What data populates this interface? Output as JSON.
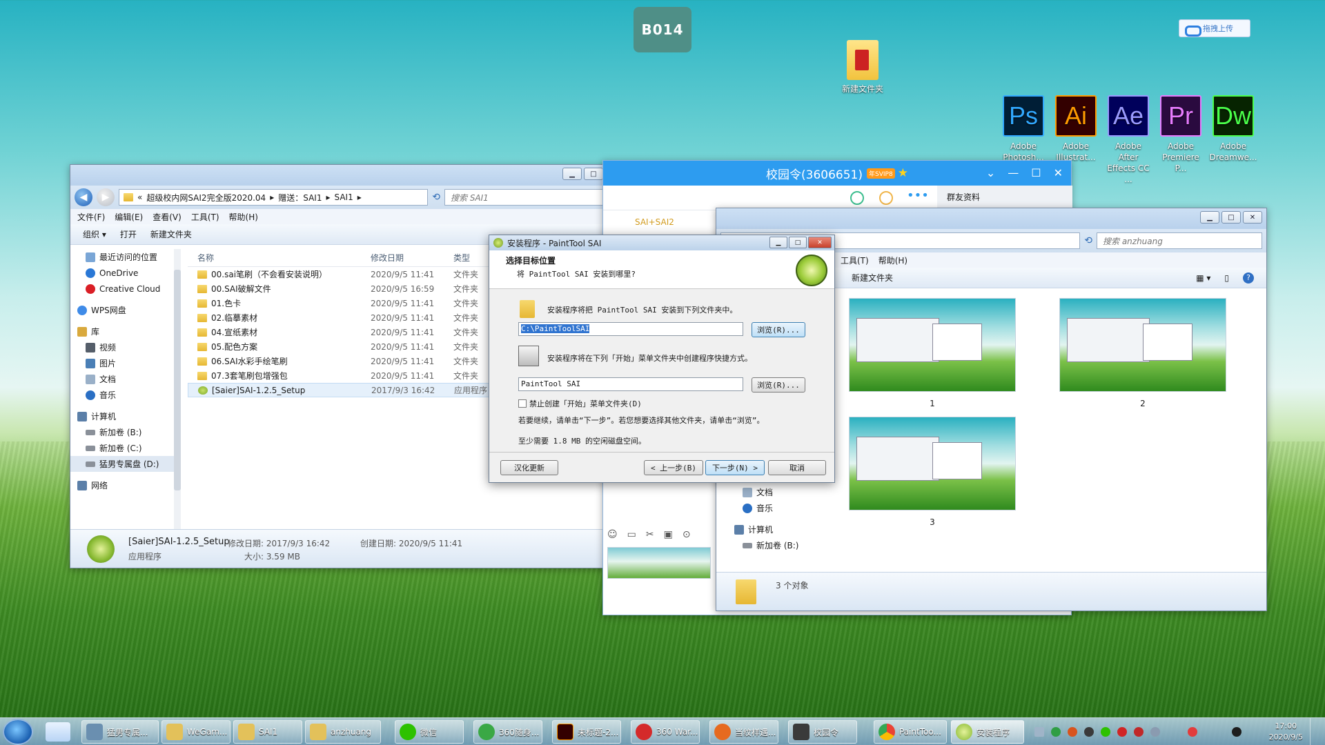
{
  "desktop": {
    "badge": "B014",
    "upload_label": "拖拽上传",
    "new_folder": "新建文件夹",
    "apps": [
      {
        "abbr": "Ps",
        "label1": "Adobe",
        "label2": "Photosh...",
        "bg": "#001e36",
        "fg": "#31a8ff"
      },
      {
        "abbr": "Ai",
        "label1": "Adobe",
        "label2": "Illustrat...",
        "bg": "#330000",
        "fg": "#ff9a00"
      },
      {
        "abbr": "Ae",
        "label1": "Adobe After",
        "label2": "Effects CC ...",
        "bg": "#00005b",
        "fg": "#9999ff"
      },
      {
        "abbr": "Pr",
        "label1": "Adobe",
        "label2": "Premiere P...",
        "bg": "#2a0a3f",
        "fg": "#e77bff"
      },
      {
        "abbr": "Dw",
        "label1": "Adobe",
        "label2": "Dreamwe...",
        "bg": "#072401",
        "fg": "#4aff4a"
      }
    ]
  },
  "explorer1": {
    "path": [
      "«",
      "超级校内网SAI2完全版2020.04",
      "赠送：SAI1",
      "SAI1"
    ],
    "search_placeholder": "搜索 SAI1",
    "menu": [
      "文件(F)",
      "编辑(E)",
      "查看(V)",
      "工具(T)",
      "帮助(H)"
    ],
    "toolbar": [
      "组织 ▾",
      "打开",
      "新建文件夹"
    ],
    "nav": [
      {
        "label": "最近访问的位置",
        "color": "#7aa6d6",
        "group": false
      },
      {
        "label": "OneDrive",
        "color": "#2a78d6",
        "group": false
      },
      {
        "label": "Creative Cloud",
        "color": "#da1f26",
        "group": false
      },
      {
        "label": "WPS网盘",
        "color": "#3f8be8",
        "group": true
      },
      {
        "label": "库",
        "color": "#d9a93d",
        "group": true
      },
      {
        "label": "视频",
        "color": "#555e6a",
        "group": false
      },
      {
        "label": "图片",
        "color": "#4a7fb6",
        "group": false
      },
      {
        "label": "文档",
        "color": "#9ab0c8",
        "group": false
      },
      {
        "label": "音乐",
        "color": "#2a6fc4",
        "group": false
      },
      {
        "label": "计算机",
        "color": "#5b7fa8",
        "group": true
      },
      {
        "label": "新加卷 (B:)",
        "color": "#8a9099",
        "group": false
      },
      {
        "label": "新加卷 (C:)",
        "color": "#8a9099",
        "group": false
      },
      {
        "label": "猛男专属盘 (D:)",
        "color": "#8a9099",
        "group": false
      },
      {
        "label": "网络",
        "color": "#5b7fa8",
        "group": true
      }
    ],
    "columns": [
      "名称",
      "修改日期",
      "类型"
    ],
    "files": [
      {
        "name": "00.sai笔刷（不会看安装说明）",
        "date": "2020/9/5 11:41",
        "type": "文件夹"
      },
      {
        "name": "00.SAI破解文件",
        "date": "2020/9/5 16:59",
        "type": "文件夹"
      },
      {
        "name": "01.色卡",
        "date": "2020/9/5 11:41",
        "type": "文件夹"
      },
      {
        "name": "02.临摹素材",
        "date": "2020/9/5 11:41",
        "type": "文件夹"
      },
      {
        "name": "04.宣纸素材",
        "date": "2020/9/5 11:41",
        "type": "文件夹"
      },
      {
        "name": "05.配色方案",
        "date": "2020/9/5 11:41",
        "type": "文件夹"
      },
      {
        "name": "06.SAI水彩手绘笔刷",
        "date": "2020/9/5 11:41",
        "type": "文件夹"
      },
      {
        "name": "07.3套笔刷包增强包",
        "date": "2020/9/5 11:41",
        "type": "文件夹"
      },
      {
        "name": "[Saier]SAI-1.2.5_Setup",
        "date": "2017/9/3 16:42",
        "type": "应用程序"
      }
    ],
    "details": {
      "name": "[Saier]SAI-1.2.5_Setup",
      "modified": "修改日期: 2017/9/3 16:42",
      "created": "创建日期: 2020/9/5 11:41",
      "kind": "应用程序",
      "size": "大小: 3.59 MB"
    }
  },
  "qq": {
    "title": "校园令(3606651)",
    "vip": "年SVIP8",
    "group_info": "群友资料",
    "file_label": "SAI+SAI2"
  },
  "explorer2": {
    "search_placeholder": "搜索 anzhuang",
    "menu": [
      "工具(T)",
      "帮助(H)"
    ],
    "toolbar": [
      "新建文件夹"
    ],
    "nav": [
      "文档",
      "音乐",
      "计算机",
      "新加卷 (B:)"
    ],
    "thumbs": [
      "1",
      "2",
      "3"
    ],
    "status": "3 个对象"
  },
  "setup": {
    "title": "安装程序 - PaintTool SAI",
    "heading": "选择目标位置",
    "subheading": "将 PaintTool SAI 安装到哪里?",
    "install_text": "安装程序将把 PaintTool SAI 安装到下列文件夹中。",
    "install_path": "C:\\PaintToolSAI",
    "browse1": "浏览(R)...",
    "start_text": "安装程序将在下列「开始」菜单文件夹中创建程序快捷方式。",
    "start_folder": "PaintTool SAI",
    "browse2": "浏览(R)...",
    "checkbox": "禁止创建「开始」菜单文件夹(D)",
    "hint": "若要继续，请单击“下一步”。若您想要选择其他文件夹，请单击“浏览”。",
    "space": "至少需要 1.8 MB 的空闲磁盘空间。",
    "btn_credit": "汉化更新",
    "btn_back": "< 上一步(B)",
    "btn_next": "下一步(N) >",
    "btn_cancel": "取消"
  },
  "taskbar": {
    "items": [
      {
        "label": "猛男专属...",
        "color": "#6a8fb0"
      },
      {
        "label": "WeGam...",
        "color": "#e3c15a"
      },
      {
        "label": "SAI1",
        "color": "#e3c15a"
      },
      {
        "label": "anzhuang",
        "color": "#e3c15a"
      },
      {
        "label": "微信",
        "color": "#2dc100"
      },
      {
        "label": "360随身...",
        "color": "#3aa845"
      },
      {
        "label": "未标题-2...",
        "color": "#330000"
      },
      {
        "label": "360 War...",
        "color": "#d42a2a"
      },
      {
        "label": "当纹样遇...",
        "color": "#e66a1f"
      },
      {
        "label": "校园令",
        "color": "#3a3a3a"
      },
      {
        "label": "PaintToo...",
        "color": "#4285f4"
      },
      {
        "label": "安装程序",
        "color": "#9ccc4a"
      }
    ],
    "time": "17:00",
    "date": "2020/9/5"
  }
}
